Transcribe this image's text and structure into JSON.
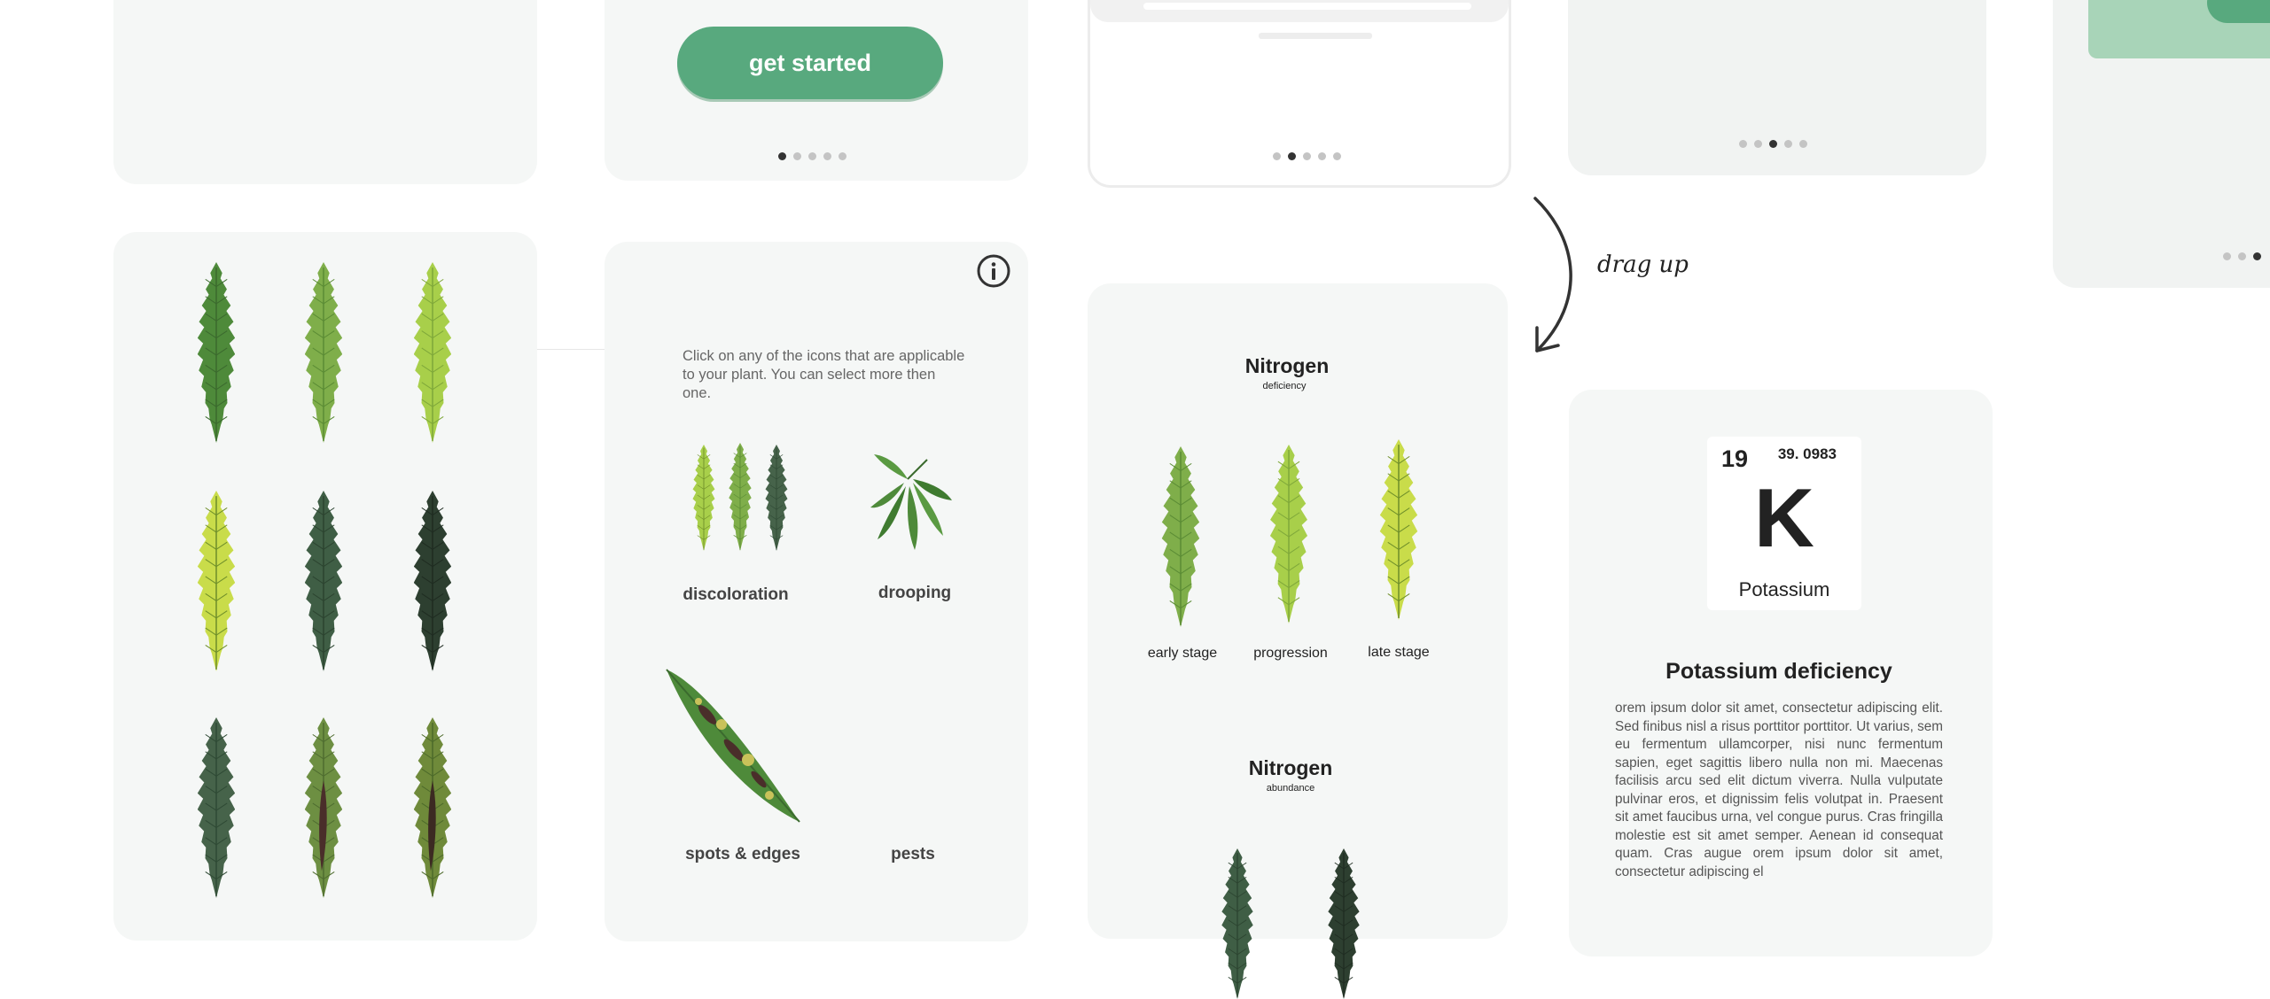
{
  "onboarding": {
    "get_started_label": "get started"
  },
  "annotation": {
    "drag_hint": "drag up"
  },
  "select_screen": {
    "instruction": "Click on any of the icons that are applicable to your plant. You can select more then one.",
    "options": [
      {
        "label": "discoloration"
      },
      {
        "label": "drooping"
      },
      {
        "label": "spots & edges"
      },
      {
        "label": "pests"
      }
    ]
  },
  "nitrogen_screen": {
    "section1": {
      "title": "Nitrogen",
      "subtitle": "deficiency"
    },
    "stages": [
      "early stage",
      "progression",
      "late stage"
    ],
    "section2": {
      "title": "Nitrogen",
      "subtitle": "abundance"
    }
  },
  "potassium_screen": {
    "atomic_number": "19",
    "atomic_mass": "39. 0983",
    "symbol": "K",
    "element_name": "Potassium",
    "heading": "Potassium deficiency",
    "body": "orem ipsum dolor sit amet, consectetur adipiscing elit. Sed finibus nisl a risus porttitor porttitor. Ut varius, sem eu fermentum ullamcorper, nisi nunc fermentum sapien, eget sagittis libero nulla non mi. Maecenas facilisis arcu sed elit dictum viverra. Nulla vulputate pulvinar eros, et dignissim felis volutpat in. Praesent sit amet faucibus urna, vel congue purus. Cras fringilla molestie est sit amet semper. Aenean id consequat quam. Cras augue orem ipsum dolor sit amet, consectetur adipiscing el"
  },
  "colors": {
    "accent": "#58a97e",
    "card_bg": "#f5f7f6",
    "leaf_dark": "#2f4a35",
    "leaf_mid": "#4e8a3a",
    "leaf_light": "#a8cf4a",
    "leaf_yellow": "#d7e04a"
  }
}
